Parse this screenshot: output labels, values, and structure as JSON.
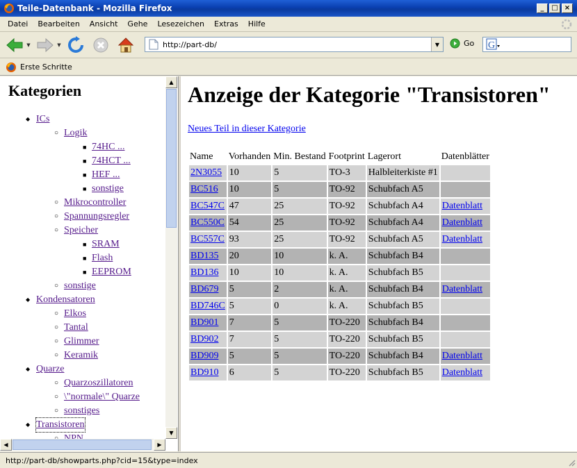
{
  "window": {
    "title": "Teile-Datenbank - Mozilla Firefox",
    "min": "_",
    "max": "□",
    "close": "×"
  },
  "menu": [
    {
      "label": "Datei"
    },
    {
      "label": "Bearbeiten"
    },
    {
      "label": "Ansicht"
    },
    {
      "label": "Gehe"
    },
    {
      "label": "Lesezeichen"
    },
    {
      "label": "Extras"
    },
    {
      "label": "Hilfe"
    }
  ],
  "nav": {
    "url": "http://part-db/",
    "go_label": "Go"
  },
  "bookmarks": [
    {
      "label": "Erste Schritte"
    }
  ],
  "sidebar": {
    "heading": "Kategorien",
    "tree": [
      {
        "label": "ICs",
        "level": 0
      },
      {
        "label": "Logik",
        "level": 1
      },
      {
        "label": "74HC ...",
        "level": 2
      },
      {
        "label": "74HCT ...",
        "level": 2
      },
      {
        "label": "HEF ...",
        "level": 2
      },
      {
        "label": "sonstige",
        "level": 2
      },
      {
        "label": "Mikrocontroller",
        "level": 1
      },
      {
        "label": "Spannungsregler",
        "level": 1
      },
      {
        "label": "Speicher",
        "level": 1
      },
      {
        "label": "SRAM",
        "level": 2
      },
      {
        "label": "Flash",
        "level": 2
      },
      {
        "label": "EEPROM",
        "level": 2
      },
      {
        "label": "sonstige",
        "level": 1
      },
      {
        "label": "Kondensatoren",
        "level": 0
      },
      {
        "label": "Elkos",
        "level": 1
      },
      {
        "label": "Tantal",
        "level": 1
      },
      {
        "label": "Glimmer",
        "level": 1
      },
      {
        "label": "Keramik",
        "level": 1
      },
      {
        "label": "Quarze",
        "level": 0
      },
      {
        "label": "Quarzoszillatoren",
        "level": 1
      },
      {
        "label": "\\\"normale\\\" Quarze",
        "level": 1
      },
      {
        "label": "sonstiges",
        "level": 1
      },
      {
        "label": "Transistoren",
        "level": 0
      },
      {
        "label": "NPN",
        "level": 1
      }
    ]
  },
  "main": {
    "heading": "Anzeige der Kategorie \"Transistoren\"",
    "new_part_link": "Neues Teil in dieser Kategorie",
    "columns": [
      "Name",
      "Vorhanden",
      "Min. Bestand",
      "Footprint",
      "Lagerort",
      "Datenblätter"
    ],
    "rows": [
      {
        "name": "2N3055",
        "vorhanden": "10",
        "min": "5",
        "footprint": "TO-3",
        "lagerort": "Halbleiterkiste #1",
        "datenblatt": ""
      },
      {
        "name": "BC516",
        "vorhanden": "10",
        "min": "5",
        "footprint": "TO-92",
        "lagerort": "Schubfach A5",
        "datenblatt": ""
      },
      {
        "name": "BC547C",
        "vorhanden": "47",
        "min": "25",
        "footprint": "TO-92",
        "lagerort": "Schubfach A4",
        "datenblatt": "Datenblatt"
      },
      {
        "name": "BC550C",
        "vorhanden": "54",
        "min": "25",
        "footprint": "TO-92",
        "lagerort": "Schubfach A4",
        "datenblatt": "Datenblatt"
      },
      {
        "name": "BC557C",
        "vorhanden": "93",
        "min": "25",
        "footprint": "TO-92",
        "lagerort": "Schubfach A5",
        "datenblatt": "Datenblatt"
      },
      {
        "name": "BD135",
        "vorhanden": "20",
        "min": "10",
        "footprint": "k. A.",
        "lagerort": "Schubfach B4",
        "datenblatt": ""
      },
      {
        "name": "BD136",
        "vorhanden": "10",
        "min": "10",
        "footprint": "k. A.",
        "lagerort": "Schubfach B5",
        "datenblatt": ""
      },
      {
        "name": "BD679",
        "vorhanden": "5",
        "min": "2",
        "footprint": "k. A.",
        "lagerort": "Schubfach B4",
        "datenblatt": "Datenblatt"
      },
      {
        "name": "BD746C",
        "vorhanden": "5",
        "min": "0",
        "footprint": "k. A.",
        "lagerort": "Schubfach B5",
        "datenblatt": ""
      },
      {
        "name": "BD901",
        "vorhanden": "7",
        "min": "5",
        "footprint": "TO-220",
        "lagerort": "Schubfach B4",
        "datenblatt": ""
      },
      {
        "name": "BD902",
        "vorhanden": "7",
        "min": "5",
        "footprint": "TO-220",
        "lagerort": "Schubfach B5",
        "datenblatt": ""
      },
      {
        "name": "BD909",
        "vorhanden": "5",
        "min": "5",
        "footprint": "TO-220",
        "lagerort": "Schubfach B4",
        "datenblatt": "Datenblatt"
      },
      {
        "name": "BD910",
        "vorhanden": "6",
        "min": "5",
        "footprint": "TO-220",
        "lagerort": "Schubfach B5",
        "datenblatt": "Datenblatt"
      }
    ]
  },
  "status": {
    "text": "http://part-db/showparts.php?cid=15&type=index"
  },
  "colors": {
    "row_light": "#d3d3d3",
    "row_dark": "#b3b3b3",
    "link": "#0000ee",
    "visited": "#551a8b"
  }
}
